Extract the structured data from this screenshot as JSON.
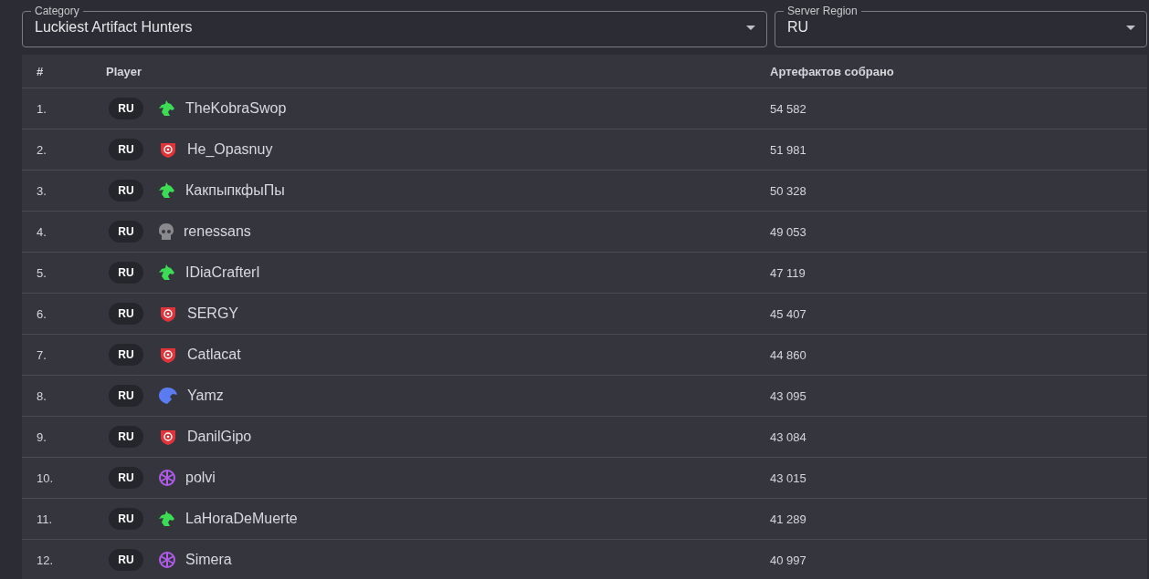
{
  "filters": [
    {
      "label": "Category",
      "value": "Luckiest Artifact Hunters"
    },
    {
      "label": "Server Region",
      "value": "RU"
    }
  ],
  "table": {
    "columns": [
      "#",
      "Player",
      "Артефактов собрано"
    ],
    "rows": [
      {
        "rank": "1.",
        "region": "RU",
        "kind": "dragon",
        "player": "TheKobraSwop",
        "value": "54 582"
      },
      {
        "rank": "2.",
        "region": "RU",
        "kind": "target",
        "player": "He_Opasnuy",
        "value": "51 981"
      },
      {
        "rank": "3.",
        "region": "RU",
        "kind": "dragon",
        "player": "КакпыпкфыПы",
        "value": "50 328"
      },
      {
        "rank": "4.",
        "region": "RU",
        "kind": "skull",
        "player": "renessans",
        "value": "49 053"
      },
      {
        "rank": "5.",
        "region": "RU",
        "kind": "dragon",
        "player": "IDiaCrafterI",
        "value": "47 119"
      },
      {
        "rank": "6.",
        "region": "RU",
        "kind": "target",
        "player": "SERGY",
        "value": "45 407"
      },
      {
        "rank": "7.",
        "region": "RU",
        "kind": "target",
        "player": "Catlacat",
        "value": "44 860"
      },
      {
        "rank": "8.",
        "region": "RU",
        "kind": "eagle",
        "player": "Yamz",
        "value": "43 095"
      },
      {
        "rank": "9.",
        "region": "RU",
        "kind": "target",
        "player": "DanilGipo",
        "value": "43 084"
      },
      {
        "rank": "10.",
        "region": "RU",
        "kind": "wheel",
        "player": "polvi",
        "value": "43 015"
      },
      {
        "rank": "11.",
        "region": "RU",
        "kind": "dragon",
        "player": "LaHoraDeMuerte",
        "value": "41 289"
      },
      {
        "rank": "12.",
        "region": "RU",
        "kind": "wheel",
        "player": "Simera",
        "value": "40 997"
      }
    ]
  }
}
